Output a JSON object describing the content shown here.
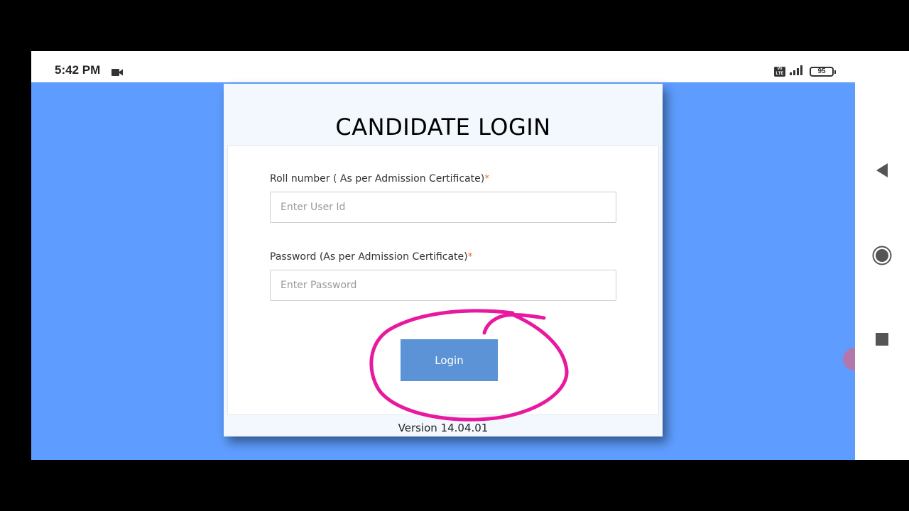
{
  "status_bar": {
    "time": "5:42 PM",
    "battery": "95",
    "volte": "Vo LTE",
    "icons": [
      "video-camera-icon",
      "volte-icon",
      "signal-icon",
      "battery-icon"
    ]
  },
  "login": {
    "title": "CANDIDATE LOGIN",
    "roll_label": "Roll number ( As per Admission Certificate)",
    "roll_required": "*",
    "roll_placeholder": "Enter User Id",
    "password_label": "Password (As per Admission Certificate)",
    "password_required": "*",
    "password_placeholder": "Enter Password",
    "login_button": "Login",
    "version": "Version 14.04.01"
  },
  "toolbar": {
    "icons": [
      "camera-icon",
      "palette-icon",
      "undo-icon",
      "trash-icon",
      "close-icon"
    ]
  },
  "navbar": {
    "icons": [
      "back-icon",
      "home-icon",
      "recents-icon"
    ]
  },
  "colors": {
    "background": "#5e9dff",
    "login_button": "#5b93d6",
    "annotation": "#e8199e",
    "required_mark": "#e8722c",
    "toolbar": "#e46676"
  }
}
